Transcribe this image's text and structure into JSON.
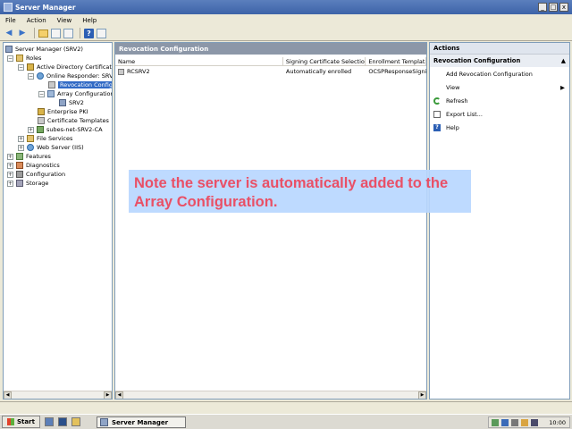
{
  "window": {
    "title": "Server Manager",
    "controls": [
      "_",
      "□",
      "x"
    ]
  },
  "menu": [
    "File",
    "Action",
    "View",
    "Help"
  ],
  "tree": {
    "items": [
      {
        "label": "Server Manager (SRV2)"
      },
      {
        "label": "Roles"
      },
      {
        "label": "Active Directory Certificate"
      },
      {
        "label": "Online Responder: SRV"
      },
      {
        "label": "Revocation Configu"
      },
      {
        "label": "Array Configuration"
      },
      {
        "label": "SRV2"
      },
      {
        "label": "Enterprise PKI"
      },
      {
        "label": "Certificate Templates"
      },
      {
        "label": "subes-net-SRV2-CA"
      },
      {
        "label": "File Services"
      },
      {
        "label": "Web Server (IIS)"
      },
      {
        "label": "Features"
      },
      {
        "label": "Diagnostics"
      },
      {
        "label": "Configuration"
      },
      {
        "label": "Storage"
      }
    ]
  },
  "center": {
    "title": "Revocation Configuration",
    "columns": [
      "Name",
      "Signing Certificate Selection",
      "Enrollment Template"
    ],
    "rows": [
      {
        "name": "RCSRV2",
        "signing": "Automatically enrolled",
        "template": "OCSPResponseSigni"
      }
    ]
  },
  "actions": {
    "title": "Actions",
    "section": "Revocation Configuration",
    "items": [
      {
        "label": "Add Revocation Configuration"
      },
      {
        "label": "View"
      },
      {
        "label": "Refresh"
      },
      {
        "label": "Export List..."
      },
      {
        "label": "Help"
      }
    ]
  },
  "note": {
    "text": "Note the server is automatically added to the Array Configuration."
  },
  "taskbar": {
    "start": "Start",
    "task": "Server Manager",
    "clock": "10:00"
  },
  "colors": {
    "note_bg": "#b9d7ff",
    "note_text": "#e8425a",
    "header": "#8c97a8",
    "selection": "#316ac5"
  }
}
